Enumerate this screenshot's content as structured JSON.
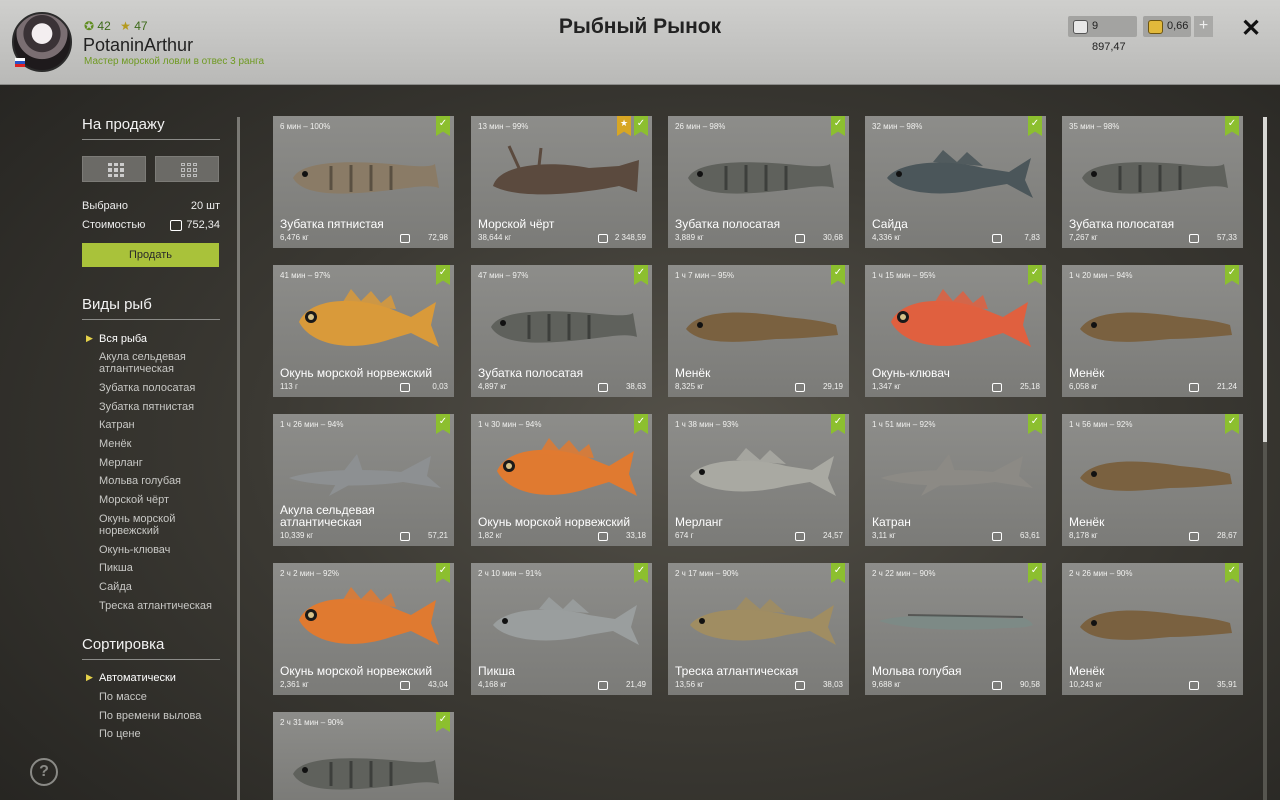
{
  "header": {
    "level": "42",
    "stars": "47",
    "username": "PotaninArthur",
    "rank": "Мастер морской ловли в отвес 3 ранга",
    "title": "Рыбный Рынок",
    "silver": "9 897,47",
    "gold": "0,66",
    "plus": "+",
    "close": "✕"
  },
  "sidebar": {
    "for_sale_heading": "На продажу",
    "selected_label": "Выбрано",
    "selected_value": "20 шт",
    "cost_label": "Стоимостью",
    "cost_value": "752,34",
    "sell_label": "Продать",
    "species_heading": "Виды рыб",
    "species": [
      "Вся рыба",
      "Акула сельдевая атлантическая",
      "Зубатка полосатая",
      "Зубатка пятнистая",
      "Катран",
      "Менёк",
      "Мерланг",
      "Мольва голубая",
      "Морской чёрт",
      "Окунь морской норвежский",
      "Окунь-клювач",
      "Пикша",
      "Сайда",
      "Треска атлантическая"
    ],
    "sort_heading": "Сортировка",
    "sort": [
      "Автоматически",
      "По массе",
      "По времени вылова",
      "По цене"
    ],
    "help": "?"
  },
  "colors": {
    "accent": "#a9c23a",
    "check": "#8cbf2f",
    "favorite": "#d7a624"
  },
  "cards": [
    {
      "time": "6 мин – 100%",
      "name": "Зубатка пятнистая",
      "weight": "6,476 кг",
      "price": "72,98",
      "fav": false,
      "shape": "catfish",
      "color": "#8a7b66"
    },
    {
      "time": "13 мин – 99%",
      "name": "Морской чёрт",
      "weight": "38,644 кг",
      "price": "2 348,59",
      "fav": true,
      "shape": "anglerfish",
      "color": "#5b4a3e"
    },
    {
      "time": "26 мин – 98%",
      "name": "Зубатка полосатая",
      "weight": "3,889 кг",
      "price": "30,68",
      "fav": false,
      "shape": "catfish",
      "color": "#5f615c"
    },
    {
      "time": "32 мин – 98%",
      "name": "Сайда",
      "weight": "4,336 кг",
      "price": "7,83",
      "fav": false,
      "shape": "cod",
      "color": "#4b565a"
    },
    {
      "time": "35 мин – 98%",
      "name": "Зубатка полосатая",
      "weight": "7,267 кг",
      "price": "57,33",
      "fav": false,
      "shape": "catfish",
      "color": "#5f615c"
    },
    {
      "time": "41 мин – 97%",
      "name": "Окунь морской норвежский",
      "weight": "113 г",
      "price": "0,03",
      "fav": false,
      "shape": "perch",
      "color": "#d99a3a"
    },
    {
      "time": "47 мин – 97%",
      "name": "Зубатка полосатая",
      "weight": "4,897 кг",
      "price": "38,63",
      "fav": false,
      "shape": "catfish",
      "color": "#5f615c"
    },
    {
      "time": "1 ч 7 мин – 95%",
      "name": "Менёк",
      "weight": "8,325 кг",
      "price": "29,19",
      "fav": false,
      "shape": "eelpout",
      "color": "#7a6140"
    },
    {
      "time": "1 ч 15 мин – 95%",
      "name": "Окунь-клювач",
      "weight": "1,347 кг",
      "price": "25,18",
      "fav": false,
      "shape": "perch",
      "color": "#e0603f"
    },
    {
      "time": "1 ч 20 мин – 94%",
      "name": "Менёк",
      "weight": "6,058 кг",
      "price": "21,24",
      "fav": false,
      "shape": "eelpout",
      "color": "#7a6140"
    },
    {
      "time": "1 ч 26 мин – 94%",
      "name": "Акула сельдевая атлантическая",
      "weight": "10,339 кг",
      "price": "57,21",
      "fav": false,
      "shape": "shark",
      "color": "#8d9092"
    },
    {
      "time": "1 ч 30 мин – 94%",
      "name": "Окунь морской норвежский",
      "weight": "1,82 кг",
      "price": "33,18",
      "fav": false,
      "shape": "perch",
      "color": "#e07a30"
    },
    {
      "time": "1 ч 38 мин – 93%",
      "name": "Мерланг",
      "weight": "674 г",
      "price": "24,57",
      "fav": false,
      "shape": "cod",
      "color": "#a9a9a2"
    },
    {
      "time": "1 ч 51 мин – 92%",
      "name": "Катран",
      "weight": "3,11 кг",
      "price": "63,61",
      "fav": false,
      "shape": "shark",
      "color": "#8c8a85"
    },
    {
      "time": "1 ч 56 мин – 92%",
      "name": "Менёк",
      "weight": "8,178 кг",
      "price": "28,67",
      "fav": false,
      "shape": "eelpout",
      "color": "#7a6140"
    },
    {
      "time": "2 ч 2 мин – 92%",
      "name": "Окунь морской норвежский",
      "weight": "2,361 кг",
      "price": "43,04",
      "fav": false,
      "shape": "perch",
      "color": "#e07a30"
    },
    {
      "time": "2 ч 10 мин – 91%",
      "name": "Пикша",
      "weight": "4,168 кг",
      "price": "21,49",
      "fav": false,
      "shape": "cod",
      "color": "#9a9e9e"
    },
    {
      "time": "2 ч 17 мин – 90%",
      "name": "Треска атлантическая",
      "weight": "13,56 кг",
      "price": "38,03",
      "fav": false,
      "shape": "cod",
      "color": "#a08d62"
    },
    {
      "time": "2 ч 22 мин – 90%",
      "name": "Мольва голубая",
      "weight": "9,688 кг",
      "price": "90,58",
      "fav": false,
      "shape": "eel",
      "color": "#7d8a86"
    },
    {
      "time": "2 ч 26 мин – 90%",
      "name": "Менёк",
      "weight": "10,243 кг",
      "price": "35,91",
      "fav": false,
      "shape": "eelpout",
      "color": "#7a6140"
    },
    {
      "time": "2 ч 31 мин – 90%",
      "name": "",
      "weight": "",
      "price": "",
      "fav": false,
      "shape": "catfish",
      "color": "#5f615c"
    }
  ]
}
